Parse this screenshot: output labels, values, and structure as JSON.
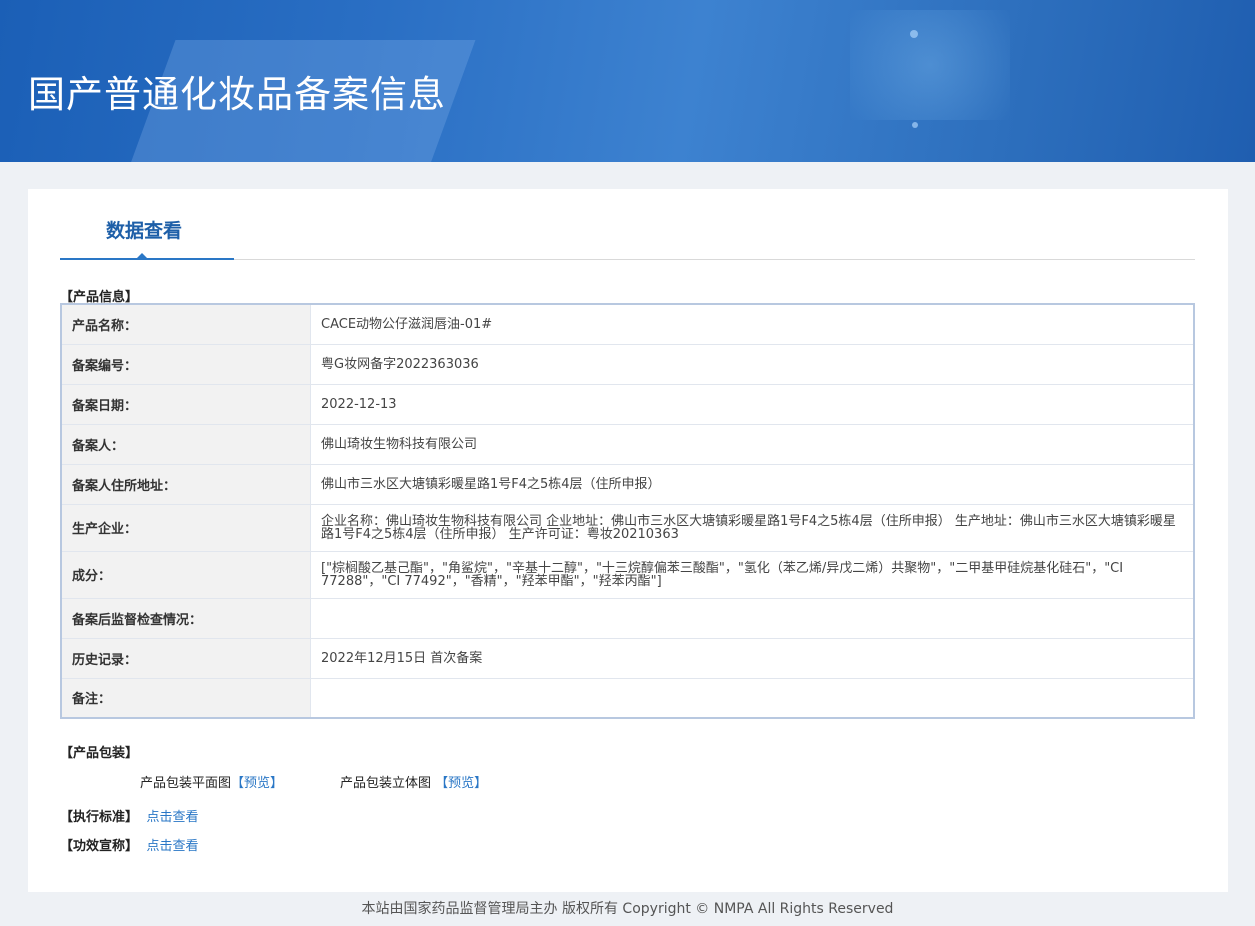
{
  "banner": {
    "title": "国产普通化妆品备案信息"
  },
  "tab": {
    "label": "数据查看"
  },
  "product_info": {
    "section_title": "【产品信息】",
    "rows": [
      {
        "label": "产品名称：",
        "value": "CACE动物公仔滋润唇油-01#"
      },
      {
        "label": "备案编号：",
        "value": "粤G妆网备字2022363036"
      },
      {
        "label": "备案日期：",
        "value": "2022-12-13"
      },
      {
        "label": "备案人：",
        "value": "佛山琦妆生物科技有限公司"
      },
      {
        "label": "备案人住所地址：",
        "value": "佛山市三水区大塘镇彩暖星路1号F4之5栋4层（住所申报）"
      },
      {
        "label": "生产企业：",
        "value": "企业名称：佛山琦妆生物科技有限公司 企业地址：佛山市三水区大塘镇彩暖星路1号F4之5栋4层（住所申报） 生产地址：佛山市三水区大塘镇彩暖星路1号F4之5栋4层（住所申报） 生产许可证：粤妆20210363"
      },
      {
        "label": "成分：",
        "value": "[\"棕榈酸乙基己酯\"，\"角鲨烷\"，\"辛基十二醇\"，\"十三烷醇偏苯三酸酯\"，\"氢化（苯乙烯/异戊二烯）共聚物\"，\"二甲基甲硅烷基化硅石\"，\"CI 77288\"，\"CI 77492\"，\"香精\"，\"羟苯甲酯\"，\"羟苯丙酯\"]"
      },
      {
        "label": "备案后监督检查情况：",
        "value": ""
      },
      {
        "label": "历史记录：",
        "value": "2022年12月15日 首次备案"
      },
      {
        "label": "备注：",
        "value": ""
      }
    ]
  },
  "packaging": {
    "section_title": "【产品包装】",
    "flat_label": "产品包装平面图",
    "flat_link": "【预览】",
    "solid_label": "产品包装立体图",
    "solid_link": "【预览】"
  },
  "standard": {
    "section_title": "【执行标准】",
    "link": "点击查看"
  },
  "efficacy": {
    "section_title": "【功效宣称】",
    "link": "点击查看"
  },
  "footer": {
    "text": "本站由国家药品监督管理局主办 版权所有 Copyright © NMPA All Rights Reserved"
  },
  "colors": {
    "banner": "#2a6fc4",
    "accent": "#2a77c6",
    "label_bg": "#f2f2f2"
  }
}
